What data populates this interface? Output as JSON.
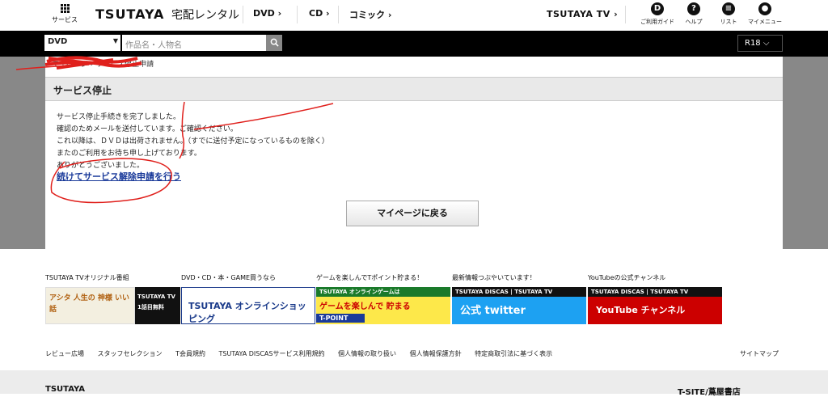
{
  "header": {
    "service_label": "サービス",
    "logo": "TSUTAYA",
    "logo_sub": "宅配レンタル",
    "nav": [
      "DVD ›",
      "CD ›",
      "コミック ›"
    ],
    "tsutaya_tv": "TSUTAYA TV ›",
    "icons": [
      {
        "name": "guide",
        "label": "ご利用ガイド",
        "glyph": "D"
      },
      {
        "name": "help",
        "label": "ヘルプ",
        "glyph": "?"
      },
      {
        "name": "list",
        "label": "リスト",
        "glyph": "≡"
      },
      {
        "name": "mymenu",
        "label": "マイメニュー",
        "glyph": "●"
      }
    ]
  },
  "search": {
    "category": "DVD",
    "placeholder": "作品名・人物名",
    "rating": "R18 ⌵"
  },
  "breadcrumb": {
    "redacted": "マイページ",
    "current": "サービス停止申請"
  },
  "page": {
    "title": "サービス停止",
    "messages": [
      "サービス停止手続きを完了しました。",
      "確認のためメールを送付しています。ご確認ください。",
      "これ以降は、ＤＶＤは出荷されません。（すでに送付予定になっているものを除く）",
      "またのご利用をお待ち申し上げております。",
      "ありがとうございました。"
    ],
    "continue_link": "続けてサービス解除申請を行う",
    "back_button": "マイページに戻る"
  },
  "promos": [
    {
      "label": "TSUTAYA TVオリジナル番組",
      "banner_a": "アシタ 人生の 神様 いい話",
      "banner_b": "TSUTAYA TV 1話目無料"
    },
    {
      "label": "DVD・CD・本・GAME買うなら",
      "banner": "TSUTAYA オンラインショッピング"
    },
    {
      "label": "ゲームを楽しんでTポイント貯まる！",
      "banner_top": "TSUTAYA オンラインゲームは",
      "banner_mid": "ゲームを楽しんで 貯まる",
      "banner_bottom": "T-POINT"
    },
    {
      "label": "最新情報つぶやいています！",
      "banner_top": "TSUTAYA DISCAS | TSUTAYA TV",
      "banner": "公式 twitter"
    },
    {
      "label": "YouTubeの公式チャンネル",
      "banner_top": "TSUTAYA DISCAS | TSUTAYA TV",
      "banner": "YouTube チャンネル"
    }
  ],
  "footer_links": [
    "レビュー広場",
    "スタッフセレクション",
    "T会員規約",
    "TSUTAYA DISCASサービス利用規約",
    "個人情報の取り扱い",
    "個人情報保護方針",
    "特定商取引法に基づく表示"
  ],
  "sitemap": "サイトマップ",
  "footer": {
    "left": "TSUTAYA",
    "right": "T-SITE/蔦屋書店"
  },
  "colors": {
    "link": "#1a3a9a",
    "annotation": "#e0201c",
    "twitter": "#1da1f2",
    "youtube": "#cc0000"
  }
}
